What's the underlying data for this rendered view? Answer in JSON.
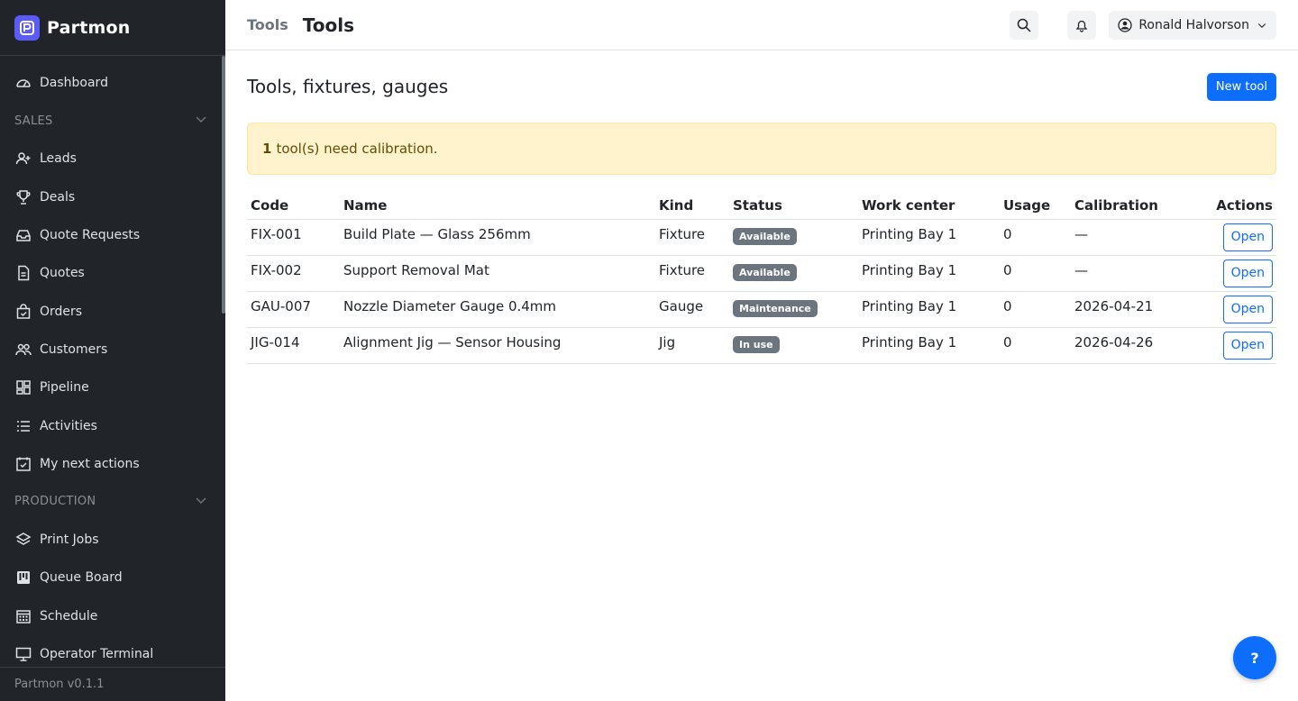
{
  "brand": {
    "name": "Partmon",
    "version": "Partmon v0.1.1"
  },
  "nav": {
    "dashboard": "Dashboard",
    "sales_section": "SALES",
    "leads": "Leads",
    "deals": "Deals",
    "quote_requests": "Quote Requests",
    "quotes": "Quotes",
    "orders": "Orders",
    "customers": "Customers",
    "pipeline": "Pipeline",
    "activities": "Activities",
    "my_next_actions": "My next actions",
    "production_section": "PRODUCTION",
    "print_jobs": "Print Jobs",
    "queue_board": "Queue Board",
    "schedule": "Schedule",
    "operator_terminal": "Operator Terminal"
  },
  "topbar": {
    "crumb": "Tools",
    "title": "Tools",
    "user": "Ronald Halvorson"
  },
  "page": {
    "heading": "Tools, fixtures, gauges",
    "new_button": "New tool"
  },
  "alert": {
    "count": "1",
    "text": "tool(s) need calibration."
  },
  "table": {
    "headers": [
      "Code",
      "Name",
      "Kind",
      "Status",
      "Work center",
      "Usage",
      "Calibration",
      "Actions"
    ],
    "rows": [
      {
        "code": "FIX-001",
        "name": "Build Plate — Glass 256mm",
        "kind": "Fixture",
        "status": "Available",
        "work_center": "Printing Bay 1",
        "usage": "0",
        "calibration": "—",
        "action": "Open"
      },
      {
        "code": "FIX-002",
        "name": "Support Removal Mat",
        "kind": "Fixture",
        "status": "Available",
        "work_center": "Printing Bay 1",
        "usage": "0",
        "calibration": "—",
        "action": "Open"
      },
      {
        "code": "GAU-007",
        "name": "Nozzle Diameter Gauge 0.4mm",
        "kind": "Gauge",
        "status": "Maintenance",
        "work_center": "Printing Bay 1",
        "usage": "0",
        "calibration": "2026-04-21",
        "action": "Open"
      },
      {
        "code": "JIG-014",
        "name": "Alignment Jig — Sensor Housing",
        "kind": "Jig",
        "status": "In use",
        "work_center": "Printing Bay 1",
        "usage": "0",
        "calibration": "2026-04-26",
        "action": "Open"
      }
    ]
  },
  "help": {
    "label": "?"
  },
  "colors": {
    "sidebar_bg": "#212529",
    "primary": "#0d6efd",
    "alert_bg": "#fff3cd",
    "alert_text": "#664d03",
    "badge_bg": "#6c757d",
    "brand_logo": "#5b5bf7"
  }
}
